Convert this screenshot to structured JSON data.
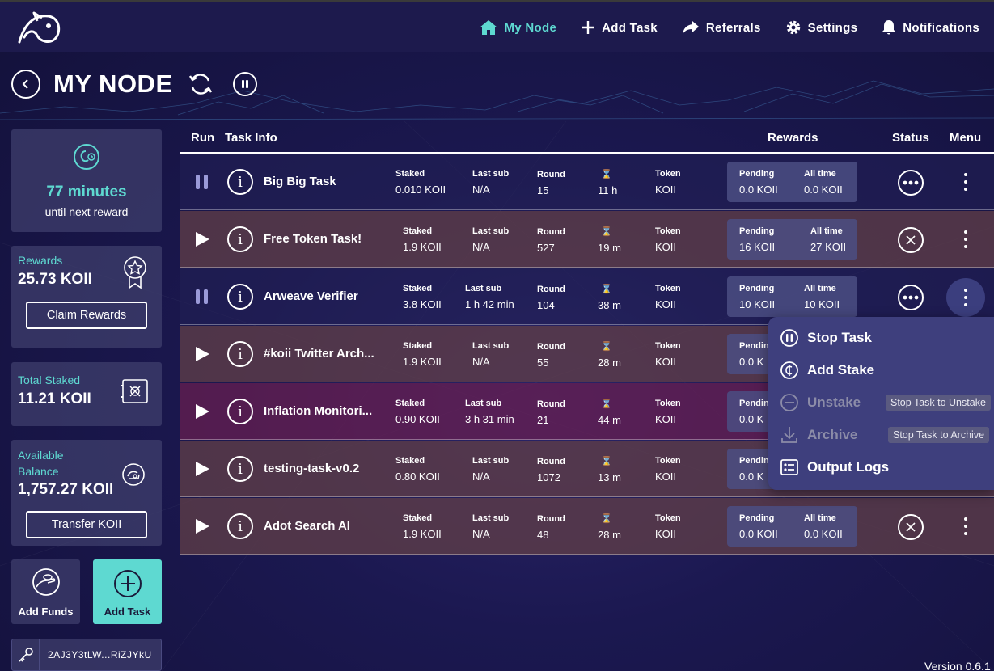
{
  "nav": {
    "items": [
      {
        "label": "My Node",
        "icon": "home-icon",
        "active": true
      },
      {
        "label": "Add Task",
        "icon": "plus-icon"
      },
      {
        "label": "Referrals",
        "icon": "share-icon"
      },
      {
        "label": "Settings",
        "icon": "gear-icon"
      },
      {
        "label": "Notifications",
        "icon": "bell-icon"
      }
    ]
  },
  "header": {
    "title": "MY NODE"
  },
  "sidebar": {
    "timer": {
      "minutes": "77 minutes",
      "until": "until next reward"
    },
    "rewards": {
      "label": "Rewards",
      "value": "25.73 KOII",
      "button": "Claim Rewards"
    },
    "staked": {
      "label": "Total Staked",
      "value": "11.21 KOII"
    },
    "balance": {
      "label_line1": "Available",
      "label_line2": "Balance",
      "value": "1,757.27 KOII",
      "button": "Transfer KOII"
    },
    "add_funds": "Add Funds",
    "add_task": "Add Task",
    "wallet": "2AJ3Y3tLW...RiZJYkU"
  },
  "table": {
    "headers": {
      "run": "Run",
      "task_info": "Task Info",
      "rewards": "Rewards",
      "status": "Status",
      "menu": "Menu"
    },
    "labels": {
      "staked": "Staked",
      "last_sub": "Last sub",
      "round": "Round",
      "hourglass": "⌛",
      "token": "Token",
      "pending": "Pending",
      "all_time": "All time"
    },
    "rows": [
      {
        "run": "pause",
        "name": "Big Big Task",
        "staked": "0.010 KOII",
        "last_sub": "N/A",
        "round": "15",
        "time": "11 h",
        "token": "KOII",
        "pending": "0.0 KOII",
        "all_time": "0.0 KOII",
        "status": "running"
      },
      {
        "run": "play",
        "name": "Free Token Task!",
        "staked": "1.9 KOII",
        "last_sub": "N/A",
        "round": "527",
        "time": "19 m",
        "token": "KOII",
        "pending": "16 KOII",
        "all_time": "27 KOII",
        "status": "stopped"
      },
      {
        "run": "pause",
        "name": "Arweave Verifier",
        "staked": "3.8 KOII",
        "last_sub": "1 h 42 min",
        "round": "104",
        "time": "38 m",
        "token": "KOII",
        "pending": "10 KOII",
        "all_time": "10 KOII",
        "status": "running"
      },
      {
        "run": "play",
        "name": "#koii Twitter Arch...",
        "staked": "1.9 KOII",
        "last_sub": "N/A",
        "round": "55",
        "time": "28 m",
        "token": "KOII",
        "pending": "0.0 K",
        "all_time": "",
        "status": ""
      },
      {
        "run": "play",
        "name": "Inflation Monitori...",
        "staked": "0.90 KOII",
        "last_sub": "3 h 31 min",
        "round": "21",
        "time": "44 m",
        "token": "KOII",
        "pending": "0.0 K",
        "all_time": "",
        "status": ""
      },
      {
        "run": "play",
        "name": "testing-task-v0.2",
        "staked": "0.80 KOII",
        "last_sub": "N/A",
        "round": "1072",
        "time": "13 m",
        "token": "KOII",
        "pending": "0.0 K",
        "all_time": "",
        "status": ""
      },
      {
        "run": "play",
        "name": "Adot Search AI",
        "staked": "1.9 KOII",
        "last_sub": "N/A",
        "round": "48",
        "time": "28 m",
        "token": "KOII",
        "pending": "0.0 KOII",
        "all_time": "0.0 KOII",
        "status": "stopped"
      }
    ]
  },
  "popup": {
    "stop_task": "Stop Task",
    "add_stake": "Add Stake",
    "unstake": "Unstake",
    "unstake_tip": "Stop Task to Unstake",
    "archive": "Archive",
    "archive_tip": "Stop Task to Archive",
    "output_logs": "Output Logs"
  },
  "version": "Version 0.6.1",
  "colors": {
    "accent": "#5ed9d1",
    "nav_bg": "#1d1a4d",
    "popup_bg": "#3e3f7d"
  }
}
